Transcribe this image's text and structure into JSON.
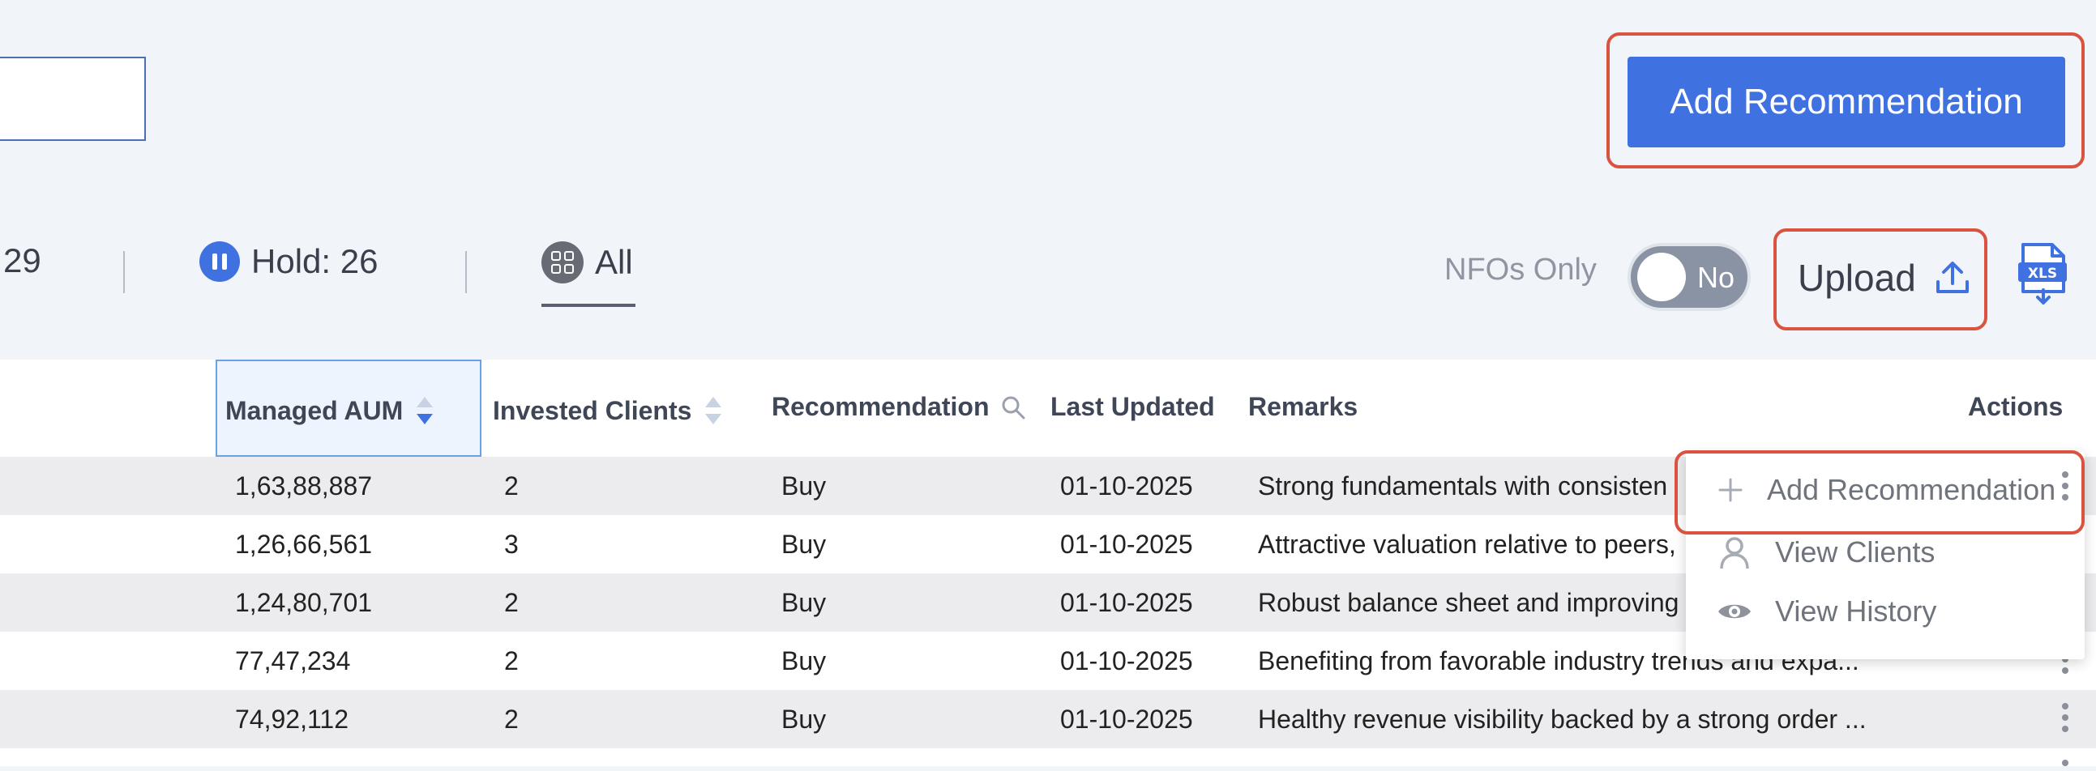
{
  "header": {
    "add_button_label": "Add Recommendation"
  },
  "stats": {
    "partial_count": "29",
    "hold_label": "Hold: 26",
    "all_label": "All"
  },
  "filters": {
    "nfo_label": "NFOs Only",
    "nfo_toggle_value": "No",
    "upload_label": "Upload"
  },
  "table": {
    "columns": [
      "Managed AUM",
      "Invested Clients",
      "Recommendation",
      "Last Updated",
      "Remarks",
      "Actions"
    ],
    "rows": [
      {
        "aum": "1,63,88,887",
        "clients": "2",
        "rec": "Buy",
        "updated": "01-10-2025",
        "remarks": "Strong fundamentals with consisten"
      },
      {
        "aum": "1,26,66,561",
        "clients": "3",
        "rec": "Buy",
        "updated": "01-10-2025",
        "remarks": "Attractive valuation relative to peers,"
      },
      {
        "aum": "1,24,80,701",
        "clients": "2",
        "rec": "Buy",
        "updated": "01-10-2025",
        "remarks": "Robust balance sheet and improving"
      },
      {
        "aum": "77,47,234",
        "clients": "2",
        "rec": "Buy",
        "updated": "01-10-2025",
        "remarks": "Benefiting from favorable industry trends and expa..."
      },
      {
        "aum": "74,92,112",
        "clients": "2",
        "rec": "Buy",
        "updated": "01-10-2025",
        "remarks": "Healthy revenue visibility backed by a strong order ..."
      }
    ]
  },
  "actions_menu": {
    "items": [
      "Add Recommendation",
      "View Clients",
      "View History"
    ]
  },
  "colors": {
    "accent": "#3f72e0",
    "highlight": "#d9533f",
    "background": "#f1f4f9"
  }
}
